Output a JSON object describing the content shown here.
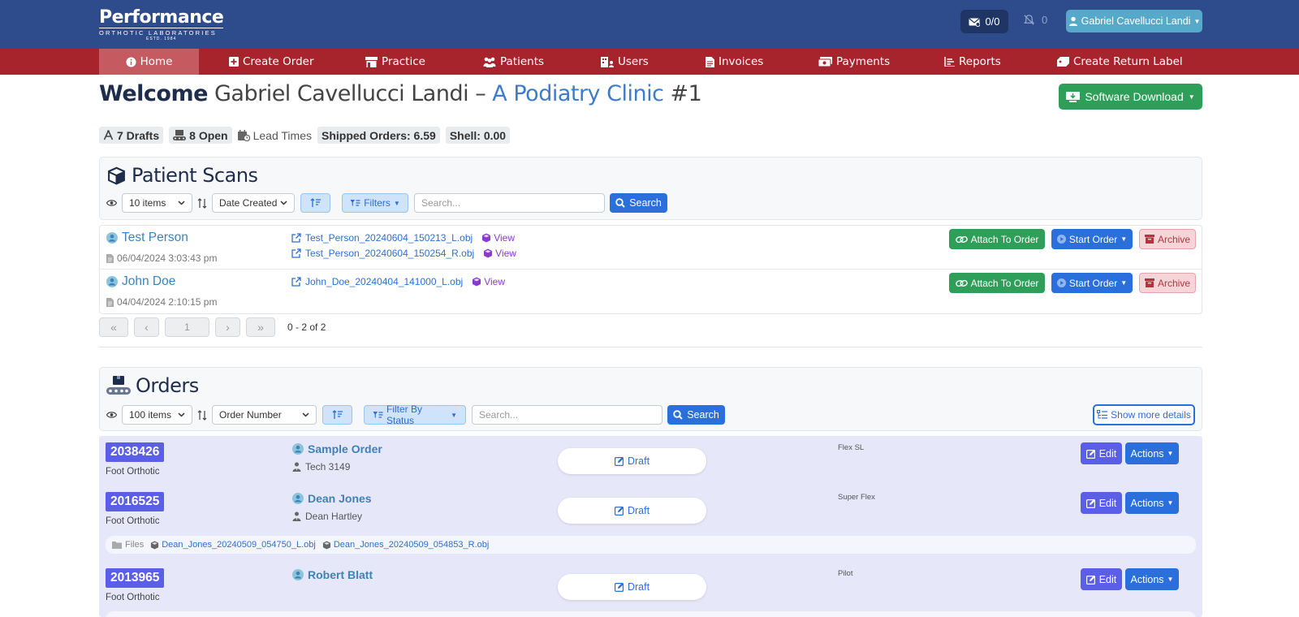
{
  "header": {
    "logo_main": "Performance",
    "logo_sub": "ORTHOTIC LABORATORIES",
    "logo_est": "ESTD. 1984",
    "messages": "0/0",
    "notifications": "0",
    "user_name": "Gabriel Cavellucci Landi"
  },
  "nav": {
    "items": [
      {
        "label": "Home",
        "icon": "info-icon"
      },
      {
        "label": "Create Order",
        "icon": "plus-square-icon"
      },
      {
        "label": "Practice",
        "icon": "shop-icon"
      },
      {
        "label": "Patients",
        "icon": "people-icon"
      },
      {
        "label": "Users",
        "icon": "users-building-icon"
      },
      {
        "label": "Invoices",
        "icon": "invoice-icon"
      },
      {
        "label": "Payments",
        "icon": "cash-icon"
      },
      {
        "label": "Reports",
        "icon": "list-icon"
      },
      {
        "label": "Create Return Label",
        "icon": "label-icon"
      }
    ]
  },
  "welcome": {
    "word": "Welcome",
    "name": "Gabriel Cavellucci Landi",
    "dash": "–",
    "clinic": "A Podiatry Clinic",
    "clinic_num": "#1",
    "software_button": "Software Download"
  },
  "stats": {
    "drafts": "7 Drafts",
    "open": "8 Open",
    "lead_times": "Lead Times",
    "shipped": "Shipped Orders: 6.59",
    "shell": "Shell: 0.00"
  },
  "scans": {
    "title": "Patient Scans",
    "items_select": "10 items",
    "sort_select": "Date Created",
    "filters_label": "Filters",
    "search_placeholder": "Search...",
    "search_button": "Search",
    "rows": [
      {
        "name": "Test Person",
        "date": "06/04/2024 3:03:43 pm",
        "files": [
          "Test_Person_20240604_150213_L.obj",
          "Test_Person_20240604_150254_R.obj"
        ],
        "view_label": "View"
      },
      {
        "name": "John Doe",
        "date": "04/04/2024 2:10:15 pm",
        "files": [
          "John_Doe_20240404_141000_L.obj"
        ],
        "view_label": "View"
      }
    ],
    "attach_label": "Attach To Order",
    "start_label": "Start Order",
    "archive_label": "Archive",
    "pager_page": "1",
    "pager_info": "0 - 2 of 2"
  },
  "orders": {
    "title": "Orders",
    "items_select": "100 items",
    "sort_select": "Order Number",
    "filter_label": "Filter By Status",
    "search_placeholder": "Search...",
    "search_button": "Search",
    "more_details": "Show more details",
    "draft_label": "Draft",
    "edit_label": "Edit",
    "actions_label": "Actions",
    "files_label": "Files",
    "rows": [
      {
        "number": "2038426",
        "type": "Foot Orthotic",
        "patient": "Sample Order",
        "tech": "Tech 3149",
        "model": "Flex SL"
      },
      {
        "number": "2016525",
        "type": "Foot Orthotic",
        "patient": "Dean Jones",
        "tech": "Dean Hartley",
        "model": "Super Flex",
        "files": [
          "Dean_Jones_20240509_054750_L.obj",
          "Dean_Jones_20240509_054853_R.obj"
        ]
      },
      {
        "number": "2013965",
        "type": "Foot Orthotic",
        "patient": "Robert Blatt",
        "tech": "",
        "model": "Pilot"
      }
    ]
  },
  "colors": {
    "header_bg": "#2e4c8c",
    "nav_bg": "#a8242d",
    "primary": "#2a6fdb",
    "success": "#2f9e59",
    "order_badge": "#5b5ee6"
  }
}
